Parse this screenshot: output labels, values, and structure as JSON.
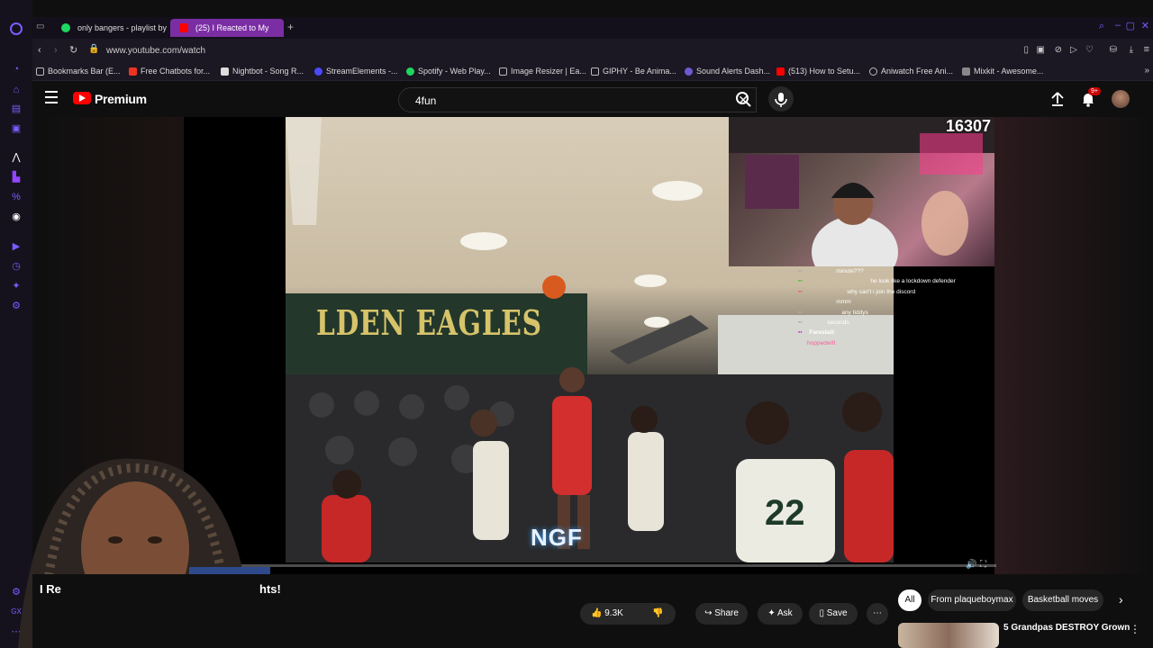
{
  "browser": {
    "tabs": [
      {
        "title": "only bangers - playlist by"
      },
      {
        "title": "(25) I Reacted to My "
      }
    ],
    "url": "www.youtube.com/watch",
    "bookmarks": [
      "Bookmarks Bar (E...",
      "Free Chatbots for...",
      "Nightbot - Song R...",
      "StreamElements -...",
      "Spotify - Web Play...",
      "Image Resizer | Ea...",
      "GIPHY - Be Anima...",
      "Sound Alerts Dash...",
      "(513) How to Setu...",
      "Aniwatch Free Ani...",
      "Mixkit - Awesome..."
    ]
  },
  "youtube": {
    "logo_label": "Premium",
    "search_value": "4fun",
    "notification_count": "9+"
  },
  "video": {
    "viewer_count": "16307",
    "gym_banner": "LDEN EAGLES",
    "jersey_number": "22",
    "watermark": "NGF",
    "chat": [
      {
        "user": "",
        "msg": "minute???"
      },
      {
        "user": "",
        "msg": "he look like a lockdown defender"
      },
      {
        "user": "",
        "msg": "why can't i join the discord"
      },
      {
        "user": "",
        "msg": "mmm"
      },
      {
        "user": "",
        "msg": "any tiddys"
      },
      {
        "user": "",
        "msg": "seconds"
      },
      {
        "user": "Farestall:",
        "msg": ""
      },
      {
        "user": "hoppedwift",
        "msg": ""
      }
    ],
    "progress": 0.08
  },
  "below": {
    "title_start": "I Re",
    "title_end": "hts!",
    "likes": "9.3K",
    "share_label": "Share",
    "ask_label": "Ask",
    "save_label": "Save",
    "chips": [
      "All",
      "From plaqueboymax",
      "Basketball moves"
    ],
    "rec_title": "5 Grandpas DESTROY Grown"
  },
  "colors": {
    "accent_youtube": "#ff0000",
    "opera_accent": "#7b2ea3",
    "bg": "#0f0f0f"
  }
}
